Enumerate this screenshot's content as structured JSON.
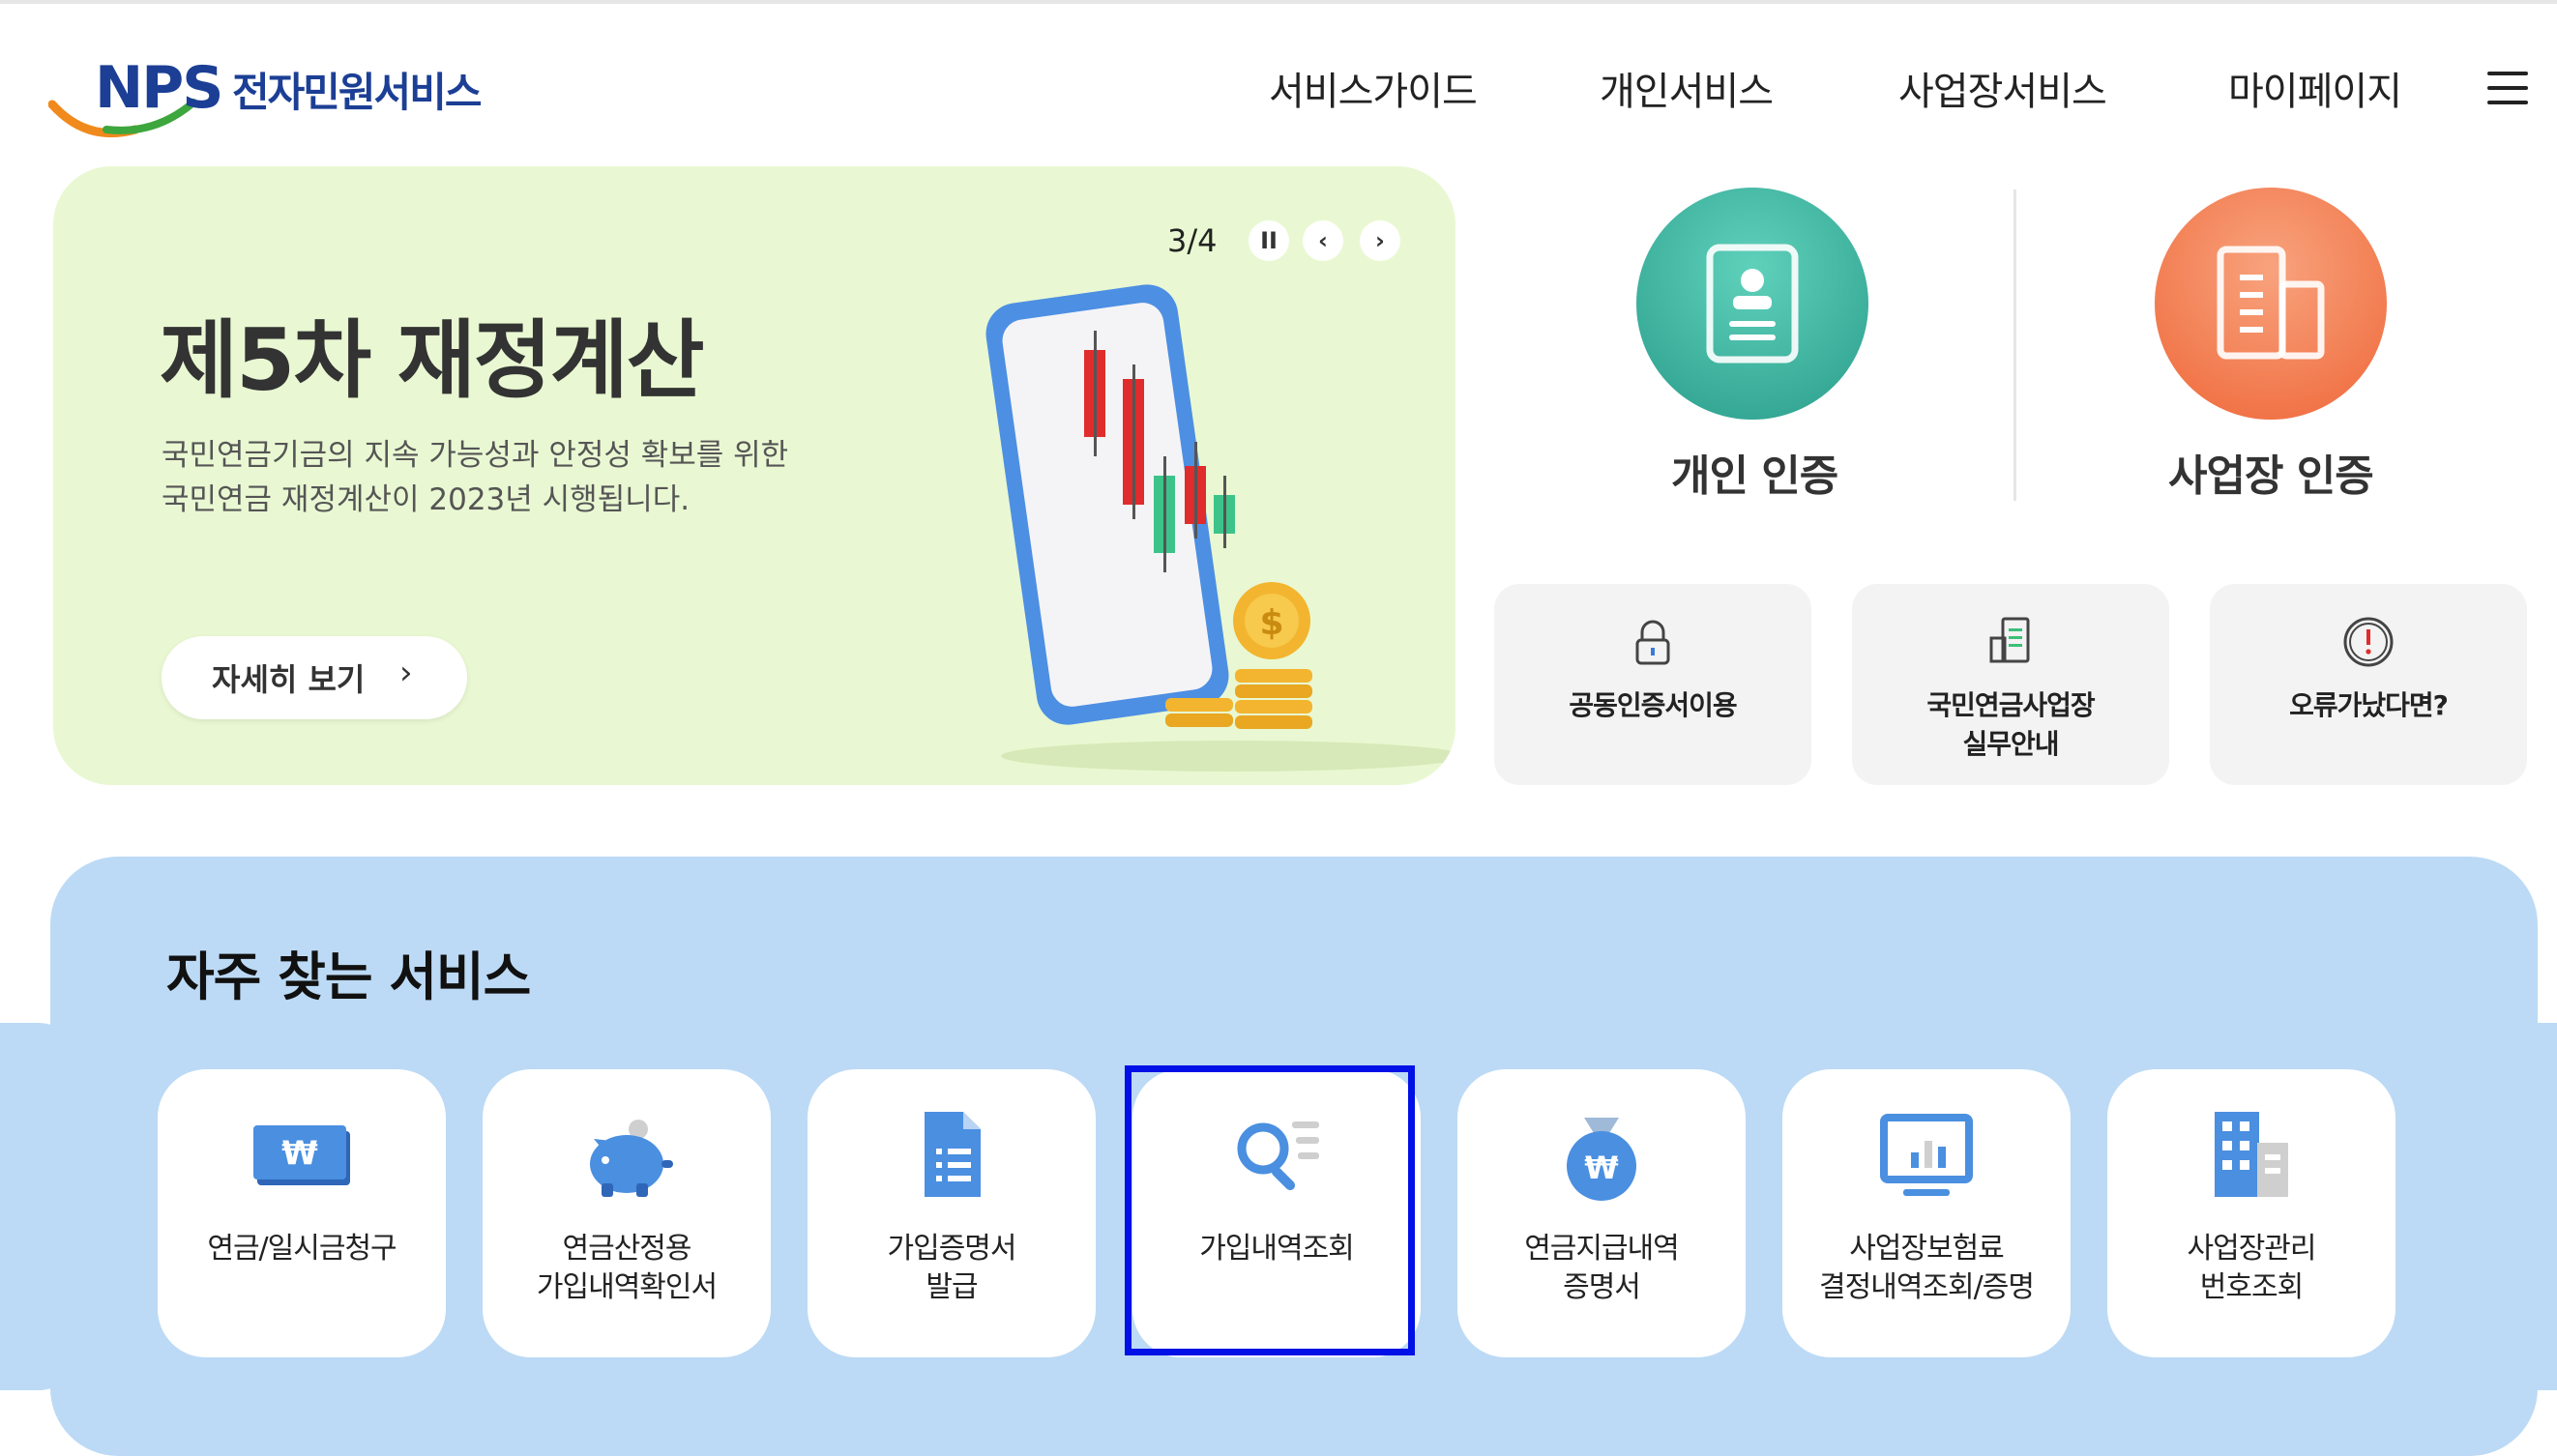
{
  "header": {
    "logo_mark": "NPS",
    "logo_text": "전자민원서비스",
    "nav": [
      "서비스가이드",
      "개인서비스",
      "사업장서비스",
      "마이페이지"
    ]
  },
  "banner": {
    "counter": "3/4",
    "title": "제5차 재정계산",
    "desc_line1": "국민연금기금의 지속 가능성과 안정성 확보를 위한",
    "desc_line2": "국민연금 재정계산이 2023년 시행됩니다.",
    "more_label": "자세히 보기"
  },
  "auth": {
    "personal": "개인 인증",
    "business": "사업장 인증"
  },
  "quick": [
    {
      "line1": "공동인증서이용",
      "line2": ""
    },
    {
      "line1": "국민연금사업장",
      "line2": "실무안내"
    },
    {
      "line1": "오류가났다면?",
      "line2": ""
    }
  ],
  "frequent": {
    "title": "자주 찾는 서비스",
    "cards": [
      {
        "line1": "연금/일시금청구",
        "line2": ""
      },
      {
        "line1": "연금산정용",
        "line2": "가입내역확인서"
      },
      {
        "line1": "가입증명서",
        "line2": "발급"
      },
      {
        "line1": "가입내역조회",
        "line2": ""
      },
      {
        "line1": "연금지급내역",
        "line2": "증명서"
      },
      {
        "line1": "사업장보험료",
        "line2": "결정내역조회/증명"
      },
      {
        "line1": "사업장관리",
        "line2": "번호조회"
      }
    ]
  },
  "colors": {
    "brand": "#1c3f95",
    "personal_auth": "#36b5a0",
    "business_auth": "#f27a4a",
    "banner_bg": "#e9f8d2",
    "frequent_bg": "#bcdaf5",
    "icon_blue": "#4a8fe0",
    "highlight": "#0010e6"
  },
  "icons": {
    "menu": "hamburger-icon",
    "personal_auth": "id-card-icon",
    "business_auth": "building-icon",
    "quick": [
      "lock-icon",
      "document-building-icon",
      "alert-icon"
    ],
    "cards": [
      "won-bill-icon",
      "piggy-bank-icon",
      "document-icon",
      "search-list-icon",
      "money-bag-icon",
      "monitor-chart-icon",
      "office-building-icon"
    ]
  }
}
